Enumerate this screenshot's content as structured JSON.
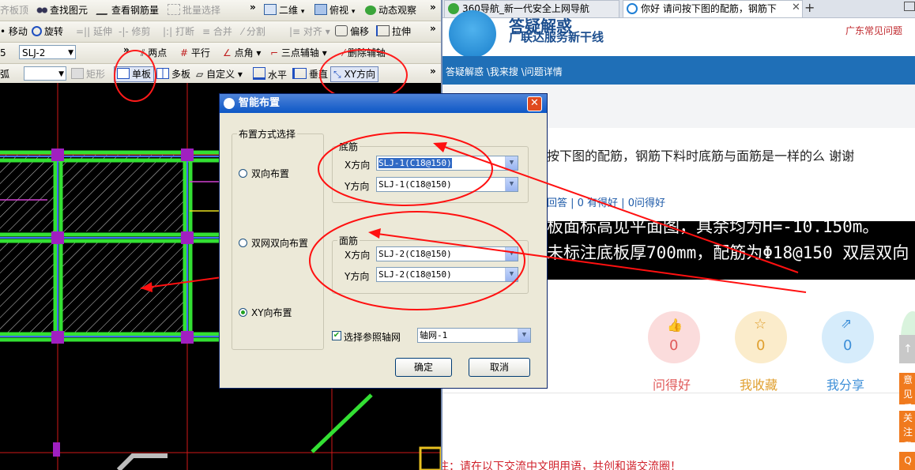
{
  "cad_app": {
    "toolbar1": {
      "items": [
        "齐板顶",
        "查找图元",
        "查看钢筋量",
        "批量选择",
        "二维",
        "俯视",
        "动态观察"
      ]
    },
    "toolbar2": {
      "items": [
        "移动",
        "旋转",
        "延伸",
        "修剪",
        "打断",
        "合并",
        "分割",
        "对齐",
        "偏移",
        "拉伸"
      ]
    },
    "toolbar3": {
      "combo_value": "SLJ-2",
      "left_fragment": "5",
      "items": [
        "两点",
        "平行",
        "点角",
        "三点辅轴",
        "删除辅轴"
      ]
    },
    "toolbar4": {
      "left_fragment": "弧",
      "items": [
        "矩形",
        "单板",
        "多板",
        "自定义",
        "水平",
        "垂直",
        "XY方向"
      ]
    }
  },
  "dialog": {
    "title": "智能布置",
    "mode_group_label": "布置方式选择",
    "modes": [
      "双向布置",
      "双网双向布置",
      "XY向布置"
    ],
    "selected_mode": "XY向布置",
    "bottom_group": {
      "label": "底筋",
      "x_label": "X方向",
      "x_value": "SLJ-1(C18@150)",
      "y_label": "Y方向",
      "y_value": "SLJ-1(C18@150)"
    },
    "top_group": {
      "label": "面筋",
      "x_label": "X方向",
      "x_value": "SLJ-2(C18@150)",
      "y_label": "Y方向",
      "y_value": "SLJ-2(C18@150)"
    },
    "ref_axis_label": "选择参照轴网",
    "ref_axis_checked": true,
    "ref_axis_value": "轴网-1",
    "ok_label": "确定",
    "cancel_label": "取消"
  },
  "browser": {
    "tabs": [
      {
        "label": "360导航_新一代安全上网导航",
        "icon": "360-icon"
      },
      {
        "label": "你好 请问按下图的配筋，钢筋下",
        "icon": "ie-icon"
      }
    ],
    "new_tab": "+",
    "brand_tagline": "广联达服务新干线",
    "brand_partial": "答疑解惑",
    "region_link": "广东常见问题",
    "nav_path": "答疑解惑 \\我来搜 \\问题详情",
    "question_partial": "按下图的配筋，钢筋下料时底筋与面筋是一样的么 谢谢",
    "stats": "回答 | 0 有得好 | 0问得好",
    "image_line1": "板面标高见平面图，具余均为H=-10.150m。",
    "image_line2": "未标注底板厚700mm，配筋为Φ18@150 双层双向",
    "actions": [
      {
        "label": "问得好",
        "count": "0",
        "color": "#e05a5a",
        "icon": "thumbs-up-icon"
      },
      {
        "label": "我收藏",
        "count": "0",
        "color": "#e0a030",
        "icon": "star-icon"
      },
      {
        "label": "我分享",
        "count": "0",
        "color": "#3d8fd8",
        "icon": "share-icon"
      }
    ],
    "side_buttons": [
      "意见反馈",
      "关注我们",
      "Q"
    ],
    "notice": "注：请在以下交流中文明用语，共创和谐交流圈！"
  }
}
